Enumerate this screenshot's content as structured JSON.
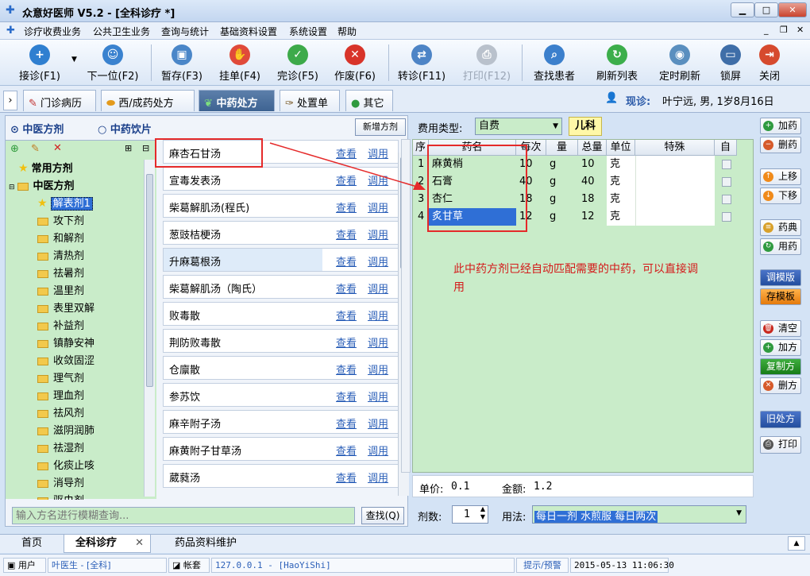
{
  "window": {
    "title": "众意好医师 V5.2 - [全科诊疗 *]"
  },
  "menu": [
    "诊疗收费业务",
    "公共卫生业务",
    "查询与统计",
    "基础资料设置",
    "系统设置",
    "帮助"
  ],
  "toolbar": [
    "接诊(F1)",
    "下一位(F2)",
    "暂存(F3)",
    "挂单(F4)",
    "完诊(F5)",
    "作废(F6)",
    "转诊(F11)",
    "打印(F12)",
    "查找患者",
    "刷新列表",
    "定时刷新",
    "锁屏",
    "关闭"
  ],
  "tabs": [
    "门诊病历",
    "西/成药处方",
    "中药处方",
    "处置单",
    "其它"
  ],
  "patient": {
    "label": "现诊:",
    "info": "叶宁远, 男, 1岁8月16日"
  },
  "left": {
    "radio1": "中医方剂",
    "radio2": "中药饮片",
    "new_button": "新增方剂",
    "tree": [
      "常用方剂",
      "中医方剂",
      "解表剂1",
      "攻下剂",
      "和解剂",
      "清热剂",
      "祛暑剂",
      "温里剂",
      "表里双解",
      "补益剂",
      "镇静安神",
      "收敛固涩",
      "理气剂",
      "理血剂",
      "祛风剂",
      "滋阴润肺",
      "祛湿剂",
      "化痰止咳",
      "消导剂",
      "驱虫剂"
    ],
    "prescriptions": [
      "麻杏石甘汤",
      "宣毒发表汤",
      "柴葛解肌汤(程氏)",
      "葱豉桔梗汤",
      "升麻葛根汤",
      "柴葛解肌汤（陶氏）",
      "败毒散",
      "荆防败毒散",
      "仓廪散",
      "参苏饮",
      "麻辛附子汤",
      "麻黄附子甘草汤",
      "葳蕤汤"
    ],
    "view_link": "查看",
    "use_link": "调用",
    "search_placeholder": "输入方名进行模糊查询...",
    "search_button": "查找(Q)"
  },
  "fee": {
    "label": "费用类型:",
    "value": "自费",
    "dept": "儿科"
  },
  "grid": {
    "headers": [
      "序",
      "药名",
      "每次",
      "量",
      "总量",
      "单位",
      "特殊",
      "自"
    ],
    "rows": [
      [
        "1",
        "麻黄梢",
        "10",
        "g",
        "10",
        "克"
      ],
      [
        "2",
        "石膏",
        "40",
        "g",
        "40",
        "克"
      ],
      [
        "3",
        "杏仁",
        "18",
        "g",
        "18",
        "克"
      ],
      [
        "4",
        "炙甘草",
        "12",
        "g",
        "12",
        "克"
      ]
    ]
  },
  "annotation": "此中药方剂已经自动匹配需要的中药，可以直接调用",
  "price": {
    "unit_label": "单价:",
    "unit": "0.1",
    "amount_label": "金额:",
    "amount": "1.2"
  },
  "dose": {
    "label": "剂数:",
    "value": "1",
    "usage_label": "用法:",
    "usage": "每日一剂 水煎服 每日两次"
  },
  "side_buttons": [
    "加药",
    "删药",
    "上移",
    "下移",
    "药典",
    "用药",
    "调模版",
    "存模板",
    "清空",
    "加方",
    "复制方",
    "删方",
    "旧处方",
    "打印"
  ],
  "bottom_tabs": [
    "首页",
    "全科诊疗",
    "药品资料维护"
  ],
  "status": [
    "用户",
    "叶医生 - [全科]",
    "帐套",
    "127.0.0.1 - [HaoYiShi]",
    "提示/预警",
    "2015-05-13 11:06:30"
  ]
}
